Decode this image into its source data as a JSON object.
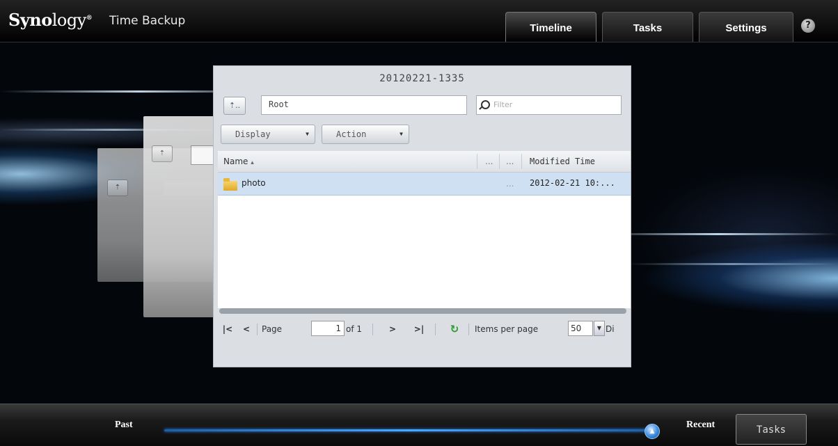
{
  "header": {
    "logo_bold": "Syno",
    "logo_light": "logy",
    "logo_mark": "®",
    "app_title": "Time Backup",
    "tabs": [
      {
        "label": "Timeline",
        "active": true
      },
      {
        "label": "Tasks",
        "active": false
      },
      {
        "label": "Settings",
        "active": false
      }
    ],
    "help": "?"
  },
  "browser": {
    "title": "20120221-1335",
    "up_icon": "folder-up-icon",
    "path": "Root",
    "filter_placeholder": "Filter",
    "display_label": "Display",
    "action_label": "Action",
    "columns": {
      "name": "Name",
      "sort_indicator": "▴",
      "col2": "...",
      "col3": "...",
      "modified": "Modified Time"
    },
    "rows": [
      {
        "icon": "folder-icon",
        "name": "photo",
        "col3": "...",
        "modified": "2012-02-21 10:..."
      }
    ],
    "pager": {
      "page_label": "Page",
      "page": "1",
      "of": "of 1",
      "items_per_page_label": "Items per page",
      "items_per_page": "50",
      "trailing": "Di"
    }
  },
  "footer": {
    "past": "Past",
    "recent": "Recent",
    "tasks": "Tasks"
  },
  "colors": {
    "accent": "#3d8be0",
    "selected_row": "#cfe0f2",
    "refresh": "#2e9b2e"
  }
}
